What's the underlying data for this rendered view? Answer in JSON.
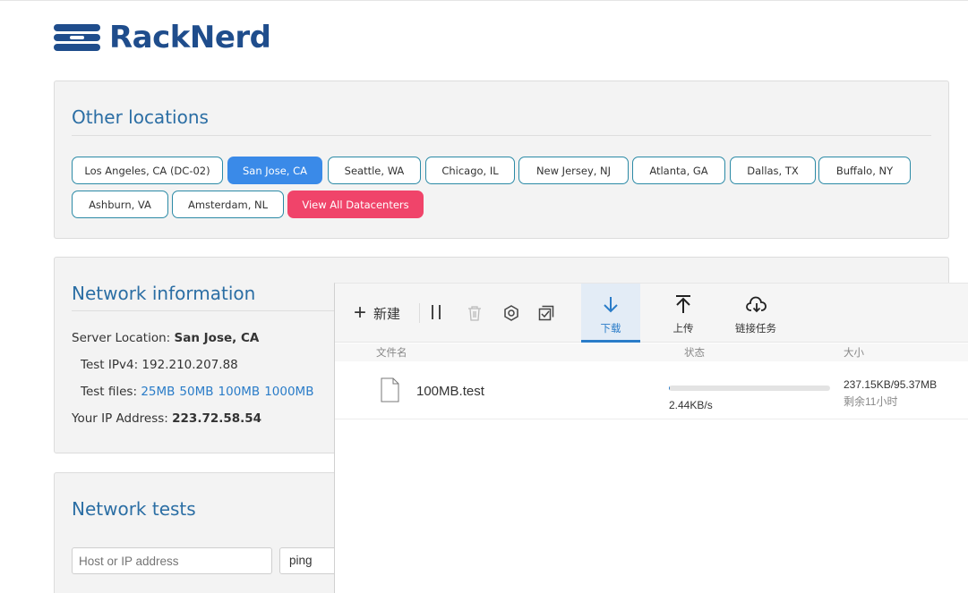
{
  "brand": {
    "name": "RackNerd",
    "color": "#1f4d8c"
  },
  "locations": {
    "title": "Other locations",
    "buttons": [
      {
        "label": "Los Angeles, CA (DC-02)",
        "state": "normal"
      },
      {
        "label": "San Jose, CA",
        "state": "active"
      },
      {
        "label": "Seattle, WA",
        "state": "normal"
      },
      {
        "label": "Chicago, IL",
        "state": "normal"
      },
      {
        "label": "New Jersey, NJ",
        "state": "normal"
      },
      {
        "label": "Atlanta, GA",
        "state": "normal"
      },
      {
        "label": "Dallas, TX",
        "state": "normal"
      },
      {
        "label": "Buffalo, NY",
        "state": "normal"
      },
      {
        "label": "Ashburn, VA",
        "state": "normal"
      },
      {
        "label": "Amsterdam, NL",
        "state": "normal"
      },
      {
        "label": "View All Datacenters",
        "state": "highlight"
      }
    ]
  },
  "network": {
    "title": "Network information",
    "server_location_label": "Server Location:",
    "server_location_value": "San Jose, CA",
    "ipv4_label": "Test IPv4:",
    "ipv4_value": "192.210.207.88",
    "files_label": "Test files:",
    "files": [
      "25MB",
      "50MB",
      "100MB",
      "1000MB"
    ],
    "your_ip_label": "Your IP Address:",
    "your_ip_value": "223.72.58.54"
  },
  "tests": {
    "title": "Network tests",
    "host_placeholder": "Host or IP address",
    "method_value": "ping"
  },
  "download_manager": {
    "toolbar": {
      "new_label": "新建",
      "tabs": [
        {
          "label": "下载",
          "icon": "download-arrow-icon",
          "active": true
        },
        {
          "label": "上传",
          "icon": "upload-arrow-icon",
          "active": false
        },
        {
          "label": "链接任务",
          "icon": "cloud-download-icon",
          "active": false
        }
      ]
    },
    "columns": {
      "name": "文件名",
      "status": "状态",
      "size": "大小"
    },
    "rows": [
      {
        "name": "100MB.test",
        "progress": 0.0024,
        "speed": "2.44KB/s",
        "size": "237.15KB/95.37MB",
        "remaining": "剩余11小时"
      }
    ],
    "accent_color": "#2a7cc8"
  },
  "colors": {
    "title": "#2b6ea4",
    "button_border": "#2b8aa6",
    "active_button": "#3a8ae8",
    "view_all_button": "#f0446a"
  }
}
